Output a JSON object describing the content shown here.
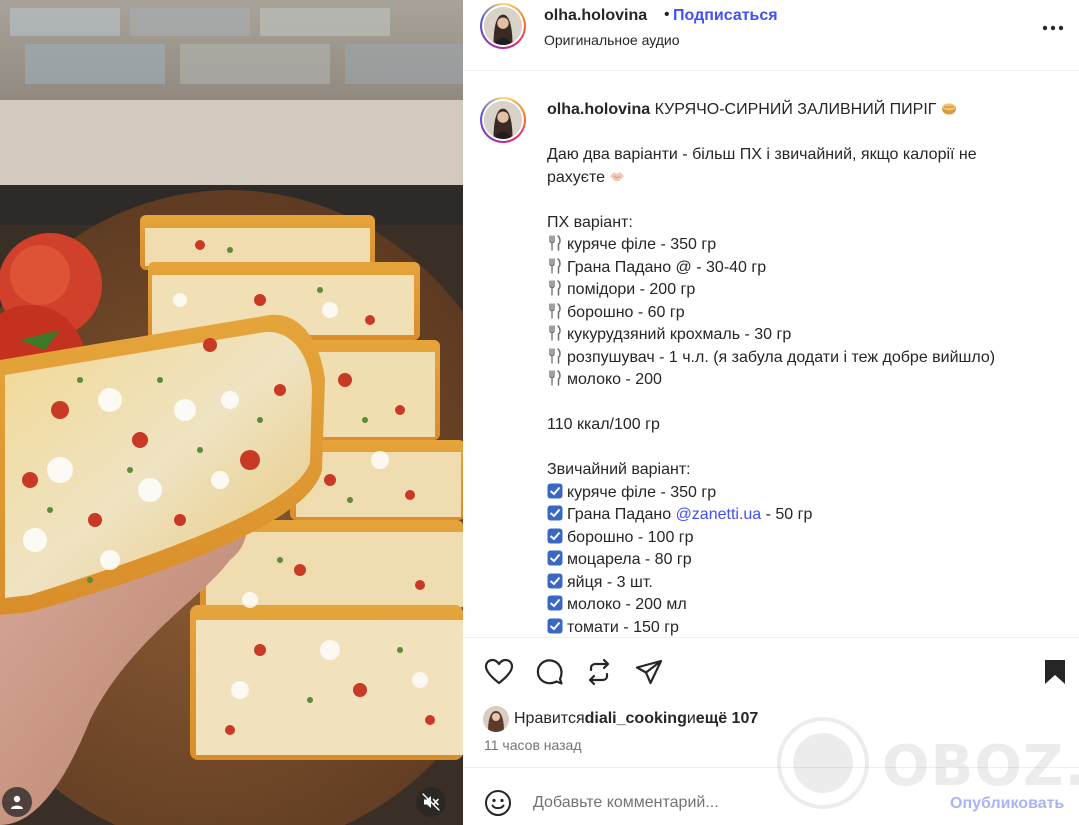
{
  "header": {
    "username": "olha.holovina",
    "separator": "•",
    "follow_label": "Подписаться",
    "audio_label": "Оригинальное аудио",
    "more_icon": "more-horizontal-icon"
  },
  "caption": {
    "username": "olha.holovina",
    "title": "КУРЯЧО-СИРНИЙ ЗАЛИВНИЙ ПИРІГ",
    "intro_line1": "Даю два варіанти - більш ПХ і звичайний, якщо калорії не",
    "intro_line2": "рахуєте",
    "pp_heading": "ПХ варіант:",
    "pp_items": [
      "куряче філе - 350 гр",
      "Грана Падано @ - 30-40 гр",
      "помідори - 200 гр",
      "борошно - 60 гр",
      "кукурудзяний крохмаль - 30 гр",
      "розпушувач - 1 ч.л. (я забула додати і теж добре вийшло)",
      "молоко - 200"
    ],
    "kcal": "110 ккал/100 гр",
    "reg_heading": "Звичайний варіант:",
    "reg_item1": "куряче філе - 350 гр",
    "reg_item2_prefix": "Грана Падано ",
    "reg_item2_mention": "@zanetti.ua",
    "reg_item2_suffix": " - 50 гр",
    "reg_items_rest": [
      "борошно - 100 гр",
      "моцарела - 80 гр",
      "яйця - 3 шт.",
      "молоко - 200 мл",
      "томати - 150 гр"
    ]
  },
  "actions": {
    "like_icon": "heart-icon",
    "comment_icon": "comment-icon",
    "repost_icon": "repost-icon",
    "share_icon": "send-icon",
    "save_icon": "bookmark-icon"
  },
  "likes": {
    "prefix": "Нравится ",
    "user": "diali_cooking",
    "middle": " и ",
    "rest": "ещё 107"
  },
  "timestamp": "11 часов назад",
  "comment": {
    "placeholder": "Добавьте комментарий...",
    "publish_label": "Опубликовать"
  },
  "watermark": "OBOZ.UA",
  "colors": {
    "accent": "#4150f7",
    "publish_disabled": "#a9b4f7",
    "muted_text": "#737373",
    "divider": "#efefef"
  }
}
